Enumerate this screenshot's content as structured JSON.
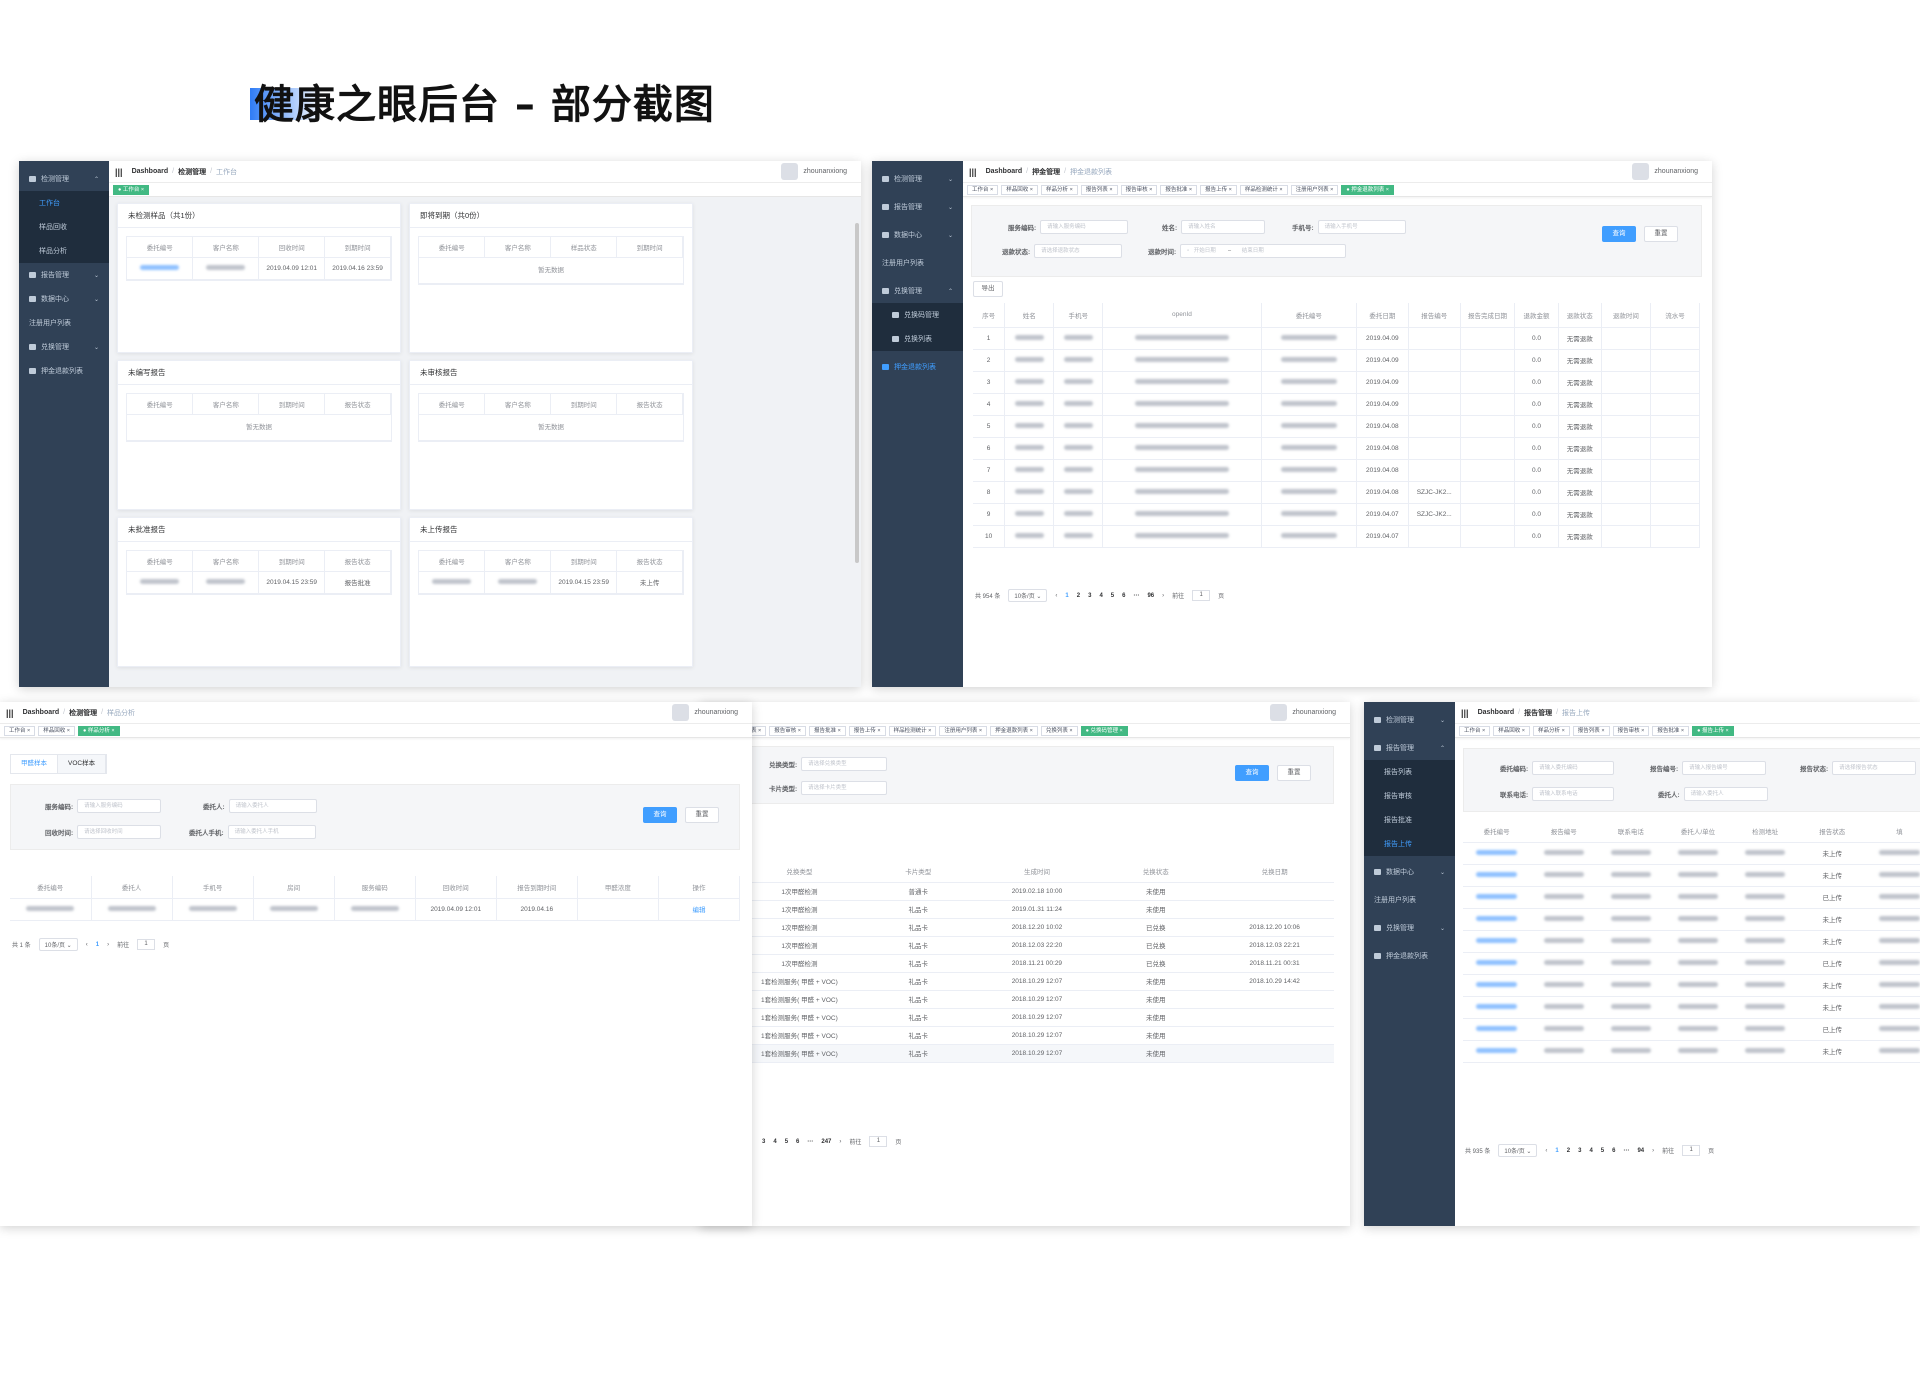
{
  "heading": "健康之眼后台 – 部分截图",
  "common": {
    "dashboard": "Dashboard",
    "user": "zhounanxiong",
    "sep": "/"
  },
  "s1": {
    "sidebar": [
      "检测管理",
      "工作台",
      "样品回收",
      "样品分析",
      "报告管理",
      "数据中心",
      "注册用户列表",
      "兑换管理",
      "押金退款列表"
    ],
    "crumb": [
      "检测管理",
      "工作台"
    ],
    "tags": [
      "工作台"
    ],
    "cards": [
      {
        "title": "未检测样品（共1份）",
        "cols": [
          "委托编号",
          "客户名称",
          "回收时间",
          "到期时间"
        ],
        "rows": [
          [
            "",
            "",
            "2019.04.09 12:01",
            "2019.04.16 23:59"
          ]
        ]
      },
      {
        "title": "即将到期（共0份）",
        "cols": [
          "委托编号",
          "客户名称",
          "样品状态",
          "到期时间"
        ],
        "empty": "暂无数据"
      },
      {
        "title": "未编写报告",
        "cols": [
          "委托编号",
          "客户名称",
          "到期时间",
          "报告状态"
        ],
        "empty": "暂无数据"
      },
      {
        "title": "未审核报告",
        "cols": [
          "委托编号",
          "客户名称",
          "到期时间",
          "报告状态"
        ],
        "empty": "暂无数据"
      },
      {
        "title": "未批准报告",
        "cols": [
          "委托编号",
          "客户名称",
          "到期时间",
          "报告状态"
        ],
        "rows": [
          [
            "",
            "",
            "2019.04.15 23:59",
            "报告批准"
          ]
        ]
      },
      {
        "title": "未上传报告",
        "cols": [
          "委托编号",
          "客户名称",
          "到期时间",
          "报告状态"
        ],
        "rows": [
          [
            "",
            "",
            "2019.04.15 23:59",
            "未上传"
          ]
        ]
      }
    ]
  },
  "s2": {
    "sidebar": [
      "检测管理",
      "报告管理",
      "数据中心",
      "注册用户列表",
      "兑换管理",
      "兑换码管理",
      "兑换列表",
      "押金退款列表"
    ],
    "crumb": [
      "押金管理",
      "押金退款列表"
    ],
    "tags": [
      "工作台",
      "样品回收",
      "样品分析",
      "报告列表",
      "报告审核",
      "报告批准",
      "报告上传",
      "样品检测统计",
      "注册用户列表",
      "押金退款列表"
    ],
    "filters": {
      "f1": "服务编码:",
      "p1": "请输入服务编码",
      "f2": "姓名:",
      "p2": "请输入姓名",
      "f3": "手机号:",
      "p3": "请输入手机号",
      "f4": "退款状态:",
      "p4": "请选择退款状态",
      "f5": "退款时间:",
      "p5a": "开始日期",
      "p5b": "结束日期",
      "dash": "–"
    },
    "query": "查询",
    "reset": "重置",
    "export": "导出",
    "cols": [
      "序号",
      "姓名",
      "手机号",
      "openId",
      "委托编号",
      "委托日期",
      "报告编号",
      "报告完成日期",
      "退款金额",
      "退款状态",
      "退款时间",
      "流水号"
    ],
    "rows": [
      [
        "1",
        "2019.04.09",
        "",
        "0.0",
        "无需退款"
      ],
      [
        "2",
        "2019.04.09",
        "",
        "0.0",
        "无需退款"
      ],
      [
        "3",
        "2019.04.09",
        "",
        "0.0",
        "无需退款"
      ],
      [
        "4",
        "2019.04.09",
        "",
        "0.0",
        "无需退款"
      ],
      [
        "5",
        "2019.04.08",
        "",
        "0.0",
        "无需退款"
      ],
      [
        "6",
        "2019.04.08",
        "",
        "0.0",
        "无需退款"
      ],
      [
        "7",
        "2019.04.08",
        "",
        "0.0",
        "无需退款"
      ],
      [
        "8",
        "2019.04.08",
        "SZJC-JK2...",
        "0.0",
        "无需退款"
      ],
      [
        "9",
        "2019.04.07",
        "SZJC-JK2...",
        "0.0",
        "无需退款"
      ],
      [
        "10",
        "2019.04.07",
        "",
        "0.0",
        "无需退款"
      ]
    ],
    "pager": {
      "total": "共 954 条",
      "size": "10条/页",
      "pages": [
        "1",
        "2",
        "3",
        "4",
        "5",
        "6",
        "···",
        "96"
      ],
      "goto": "前往",
      "page": "1",
      "unit": "页"
    }
  },
  "s3": {
    "crumb": [
      "检测管理",
      "样品分析"
    ],
    "tags": [
      "工作台",
      "样品回收",
      "样品分析"
    ],
    "tabs": [
      "甲醛样本",
      "VOC样本"
    ],
    "filters": {
      "f1": "服务编码:",
      "p1": "请输入服务编码",
      "f2": "委托人:",
      "p2": "请输入委托人",
      "f3": "回收时间:",
      "p3": "请选择回收时间",
      "f4": "委托人手机:",
      "p4": "请输入委托人手机"
    },
    "query": "查询",
    "reset": "重置",
    "cols": [
      "委托编号",
      "委托人",
      "手机号",
      "房间",
      "服务编码",
      "回收时间",
      "报告到期时间",
      "甲醛浓度",
      "操作"
    ],
    "row": [
      "2019.04.09 12:01",
      "2019.04.16",
      "编辑"
    ],
    "pager": {
      "total": "共 1 条",
      "size": "10条/页",
      "page_cur": "1",
      "goto": "前往",
      "page": "1",
      "unit": "页"
    }
  },
  "s4": {
    "tags": [
      "表",
      "报告审核",
      "报告批准",
      "报告上传",
      "样品检测统计",
      "注册用户列表",
      "押金退款列表",
      "兑换列表",
      "兑换码管理"
    ],
    "filters": {
      "f1": "兑换类型:",
      "p1": "请选择兑换类型",
      "f2": "卡片类型:",
      "p2": "请选择卡片类型"
    },
    "query": "查询",
    "reset": "重置",
    "cols": [
      "兑换类型",
      "卡片类型",
      "生成时间",
      "兑换状态",
      "兑换日期"
    ],
    "rows": [
      [
        "1次甲醛检测",
        "普通卡",
        "2019.02.18 10:00",
        "未使用",
        ""
      ],
      [
        "1次甲醛检测",
        "礼品卡",
        "2019.01.31 11:24",
        "未使用",
        ""
      ],
      [
        "1次甲醛检测",
        "礼品卡",
        "2018.12.20 10:02",
        "已兑换",
        "2018.12.20 10:06"
      ],
      [
        "1次甲醛检测",
        "礼品卡",
        "2018.12.03 22:20",
        "已兑换",
        "2018.12.03 22:21"
      ],
      [
        "1次甲醛检测",
        "礼品卡",
        "2018.11.21 00:29",
        "已兑换",
        "2018.11.21 00:31"
      ],
      [
        "1套检测服务( 甲醛 + VOC)",
        "礼品卡",
        "2018.10.29 12:07",
        "未使用",
        "2018.10.29 14:42"
      ],
      [
        "1套检测服务( 甲醛 + VOC)",
        "礼品卡",
        "2018.10.29 12:07",
        "未使用",
        ""
      ],
      [
        "1套检测服务( 甲醛 + VOC)",
        "礼品卡",
        "2018.10.29 12:07",
        "未使用",
        ""
      ],
      [
        "1套检测服务( 甲醛 + VOC)",
        "礼品卡",
        "2018.10.29 12:07",
        "未使用",
        ""
      ],
      [
        "1套检测服务( 甲醛 + VOC)",
        "礼品卡",
        "2018.10.29 12:07",
        "未使用",
        ""
      ]
    ],
    "pager": {
      "pages": [
        "3",
        "4",
        "5",
        "6",
        "···",
        "247"
      ],
      "goto": "前往",
      "page": "1",
      "unit": "页"
    }
  },
  "s5": {
    "sidebar": [
      "检测管理",
      "报告管理",
      "报告列表",
      "报告审核",
      "报告批准",
      "报告上传",
      "数据中心",
      "注册用户列表",
      "兑换管理",
      "押金退款列表"
    ],
    "crumb": [
      "报告管理",
      "报告上传"
    ],
    "tags": [
      "工作台",
      "样品回收",
      "样品分析",
      "报告列表",
      "报告审核",
      "报告批准",
      "报告上传"
    ],
    "filters": {
      "f1": "委托编码:",
      "p1": "请输入委托编码",
      "f2": "报告编号:",
      "p2": "请输入报告编号",
      "f3": "报告状态:",
      "p3": "请选择报告状态",
      "f4": "联系电话:",
      "p4": "请输入联系电话",
      "f5": "委托人:",
      "p5": "请输入委托人"
    },
    "cols": [
      "委托编号",
      "报告编号",
      "联系电话",
      "委托人/单位",
      "检测地址",
      "报告状态",
      "填"
    ],
    "status": [
      "未上传",
      "未上传",
      "已上传",
      "未上传",
      "未上传",
      "已上传",
      "未上传",
      "未上传",
      "已上传",
      "未上传"
    ],
    "pager": {
      "total": "共 935 条",
      "size": "10条/页",
      "pages": [
        "1",
        "2",
        "3",
        "4",
        "5",
        "6",
        "···",
        "94"
      ],
      "goto": "前往",
      "page": "1",
      "unit": "页"
    }
  }
}
